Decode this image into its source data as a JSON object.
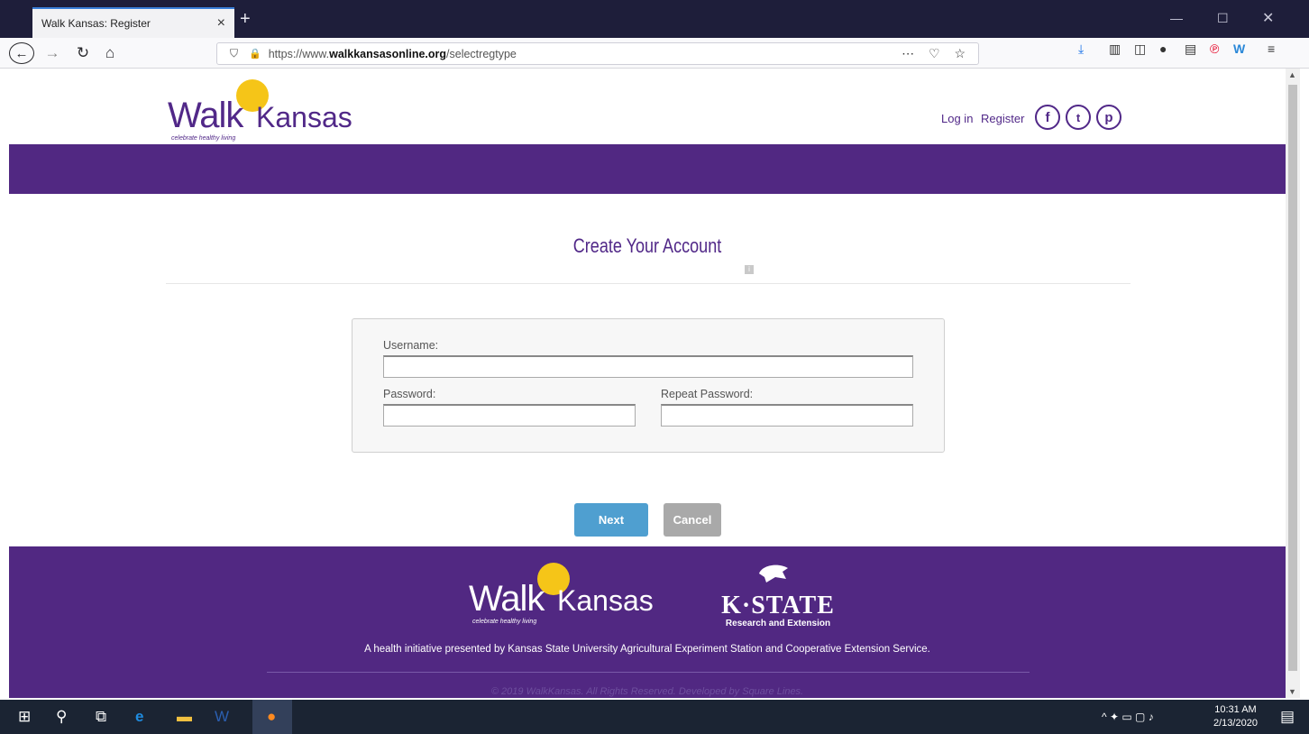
{
  "browser": {
    "tab_title": "Walk Kansas: Register",
    "url_prefix": "https://www.",
    "url_domain": "walkkansasonline.org",
    "url_path": "/selectregtype"
  },
  "header": {
    "logo_walk": "Walk",
    "logo_kansas": "Kansas",
    "logo_tagline": "celebrate healthy living",
    "login": "Log in",
    "register": "Register"
  },
  "main": {
    "title": "Create Your Account",
    "username_label": "Username:",
    "username_value": "",
    "password_label": "Password:",
    "password_value": "",
    "repeat_label": "Repeat Password:",
    "repeat_value": "",
    "next_label": "Next",
    "cancel_label": "Cancel"
  },
  "footer": {
    "kstate": "K·STATE",
    "kstate_sub": "Research and Extension",
    "text": "A health initiative presented by Kansas State University Agricultural Experiment Station and Cooperative Extension Service.",
    "copyright": "© 2019 WalkKansas. All Rights Reserved. Developed by Square Lines."
  },
  "taskbar": {
    "time": "10:31 AM",
    "date": "2/13/2020"
  },
  "colors": {
    "brand": "#512882",
    "accent": "#f5c518",
    "next": "#4f9fd0"
  }
}
